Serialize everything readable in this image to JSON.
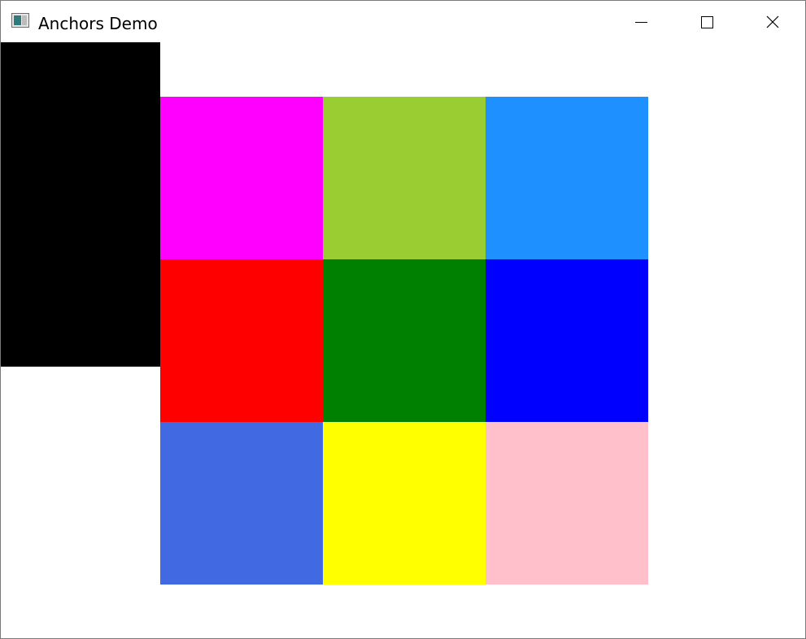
{
  "window": {
    "title": "Anchors Demo"
  },
  "icons": {
    "app": "app-window-icon",
    "minimize": "minimize-icon",
    "maximize": "maximize-icon",
    "close": "close-icon"
  },
  "anchored_rect": {
    "color": "#000000"
  },
  "grid": {
    "cells": [
      {
        "color": "#ff00ff"
      },
      {
        "color": "#9acd32"
      },
      {
        "color": "#1e90ff"
      },
      {
        "color": "#ff0000"
      },
      {
        "color": "#008000"
      },
      {
        "color": "#0000ff"
      },
      {
        "color": "#4169e1"
      },
      {
        "color": "#ffff00"
      },
      {
        "color": "#ffc0cb"
      }
    ]
  }
}
